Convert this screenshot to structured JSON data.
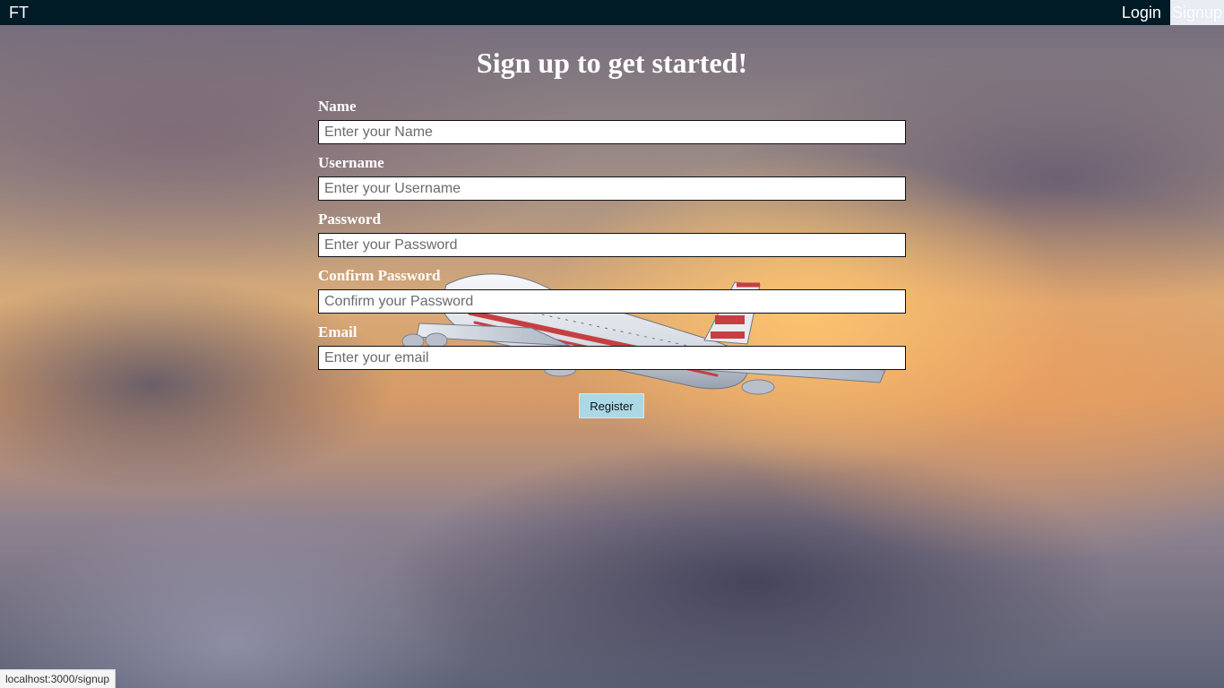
{
  "app": {
    "brand": "FT"
  },
  "nav": {
    "login": "Login",
    "signup": "Signup"
  },
  "page": {
    "title": "Sign up to get started!"
  },
  "form": {
    "name": {
      "label": "Name",
      "placeholder": "Enter your Name",
      "value": ""
    },
    "username": {
      "label": "Username",
      "placeholder": "Enter your Username",
      "value": ""
    },
    "password": {
      "label": "Password",
      "placeholder": "Enter your Password",
      "value": ""
    },
    "confirm_password": {
      "label": "Confirm Password",
      "placeholder": "Confirm your Password",
      "value": ""
    },
    "email": {
      "label": "Email",
      "placeholder": "Enter your email",
      "value": ""
    },
    "submit_label": "Register"
  },
  "status": {
    "url": "localhost:3000/signup"
  },
  "colors": {
    "navbar": "#001a26",
    "button": "#acd8e6",
    "text_light": "#ffffff"
  },
  "background": {
    "icon": "airplane-icon"
  }
}
